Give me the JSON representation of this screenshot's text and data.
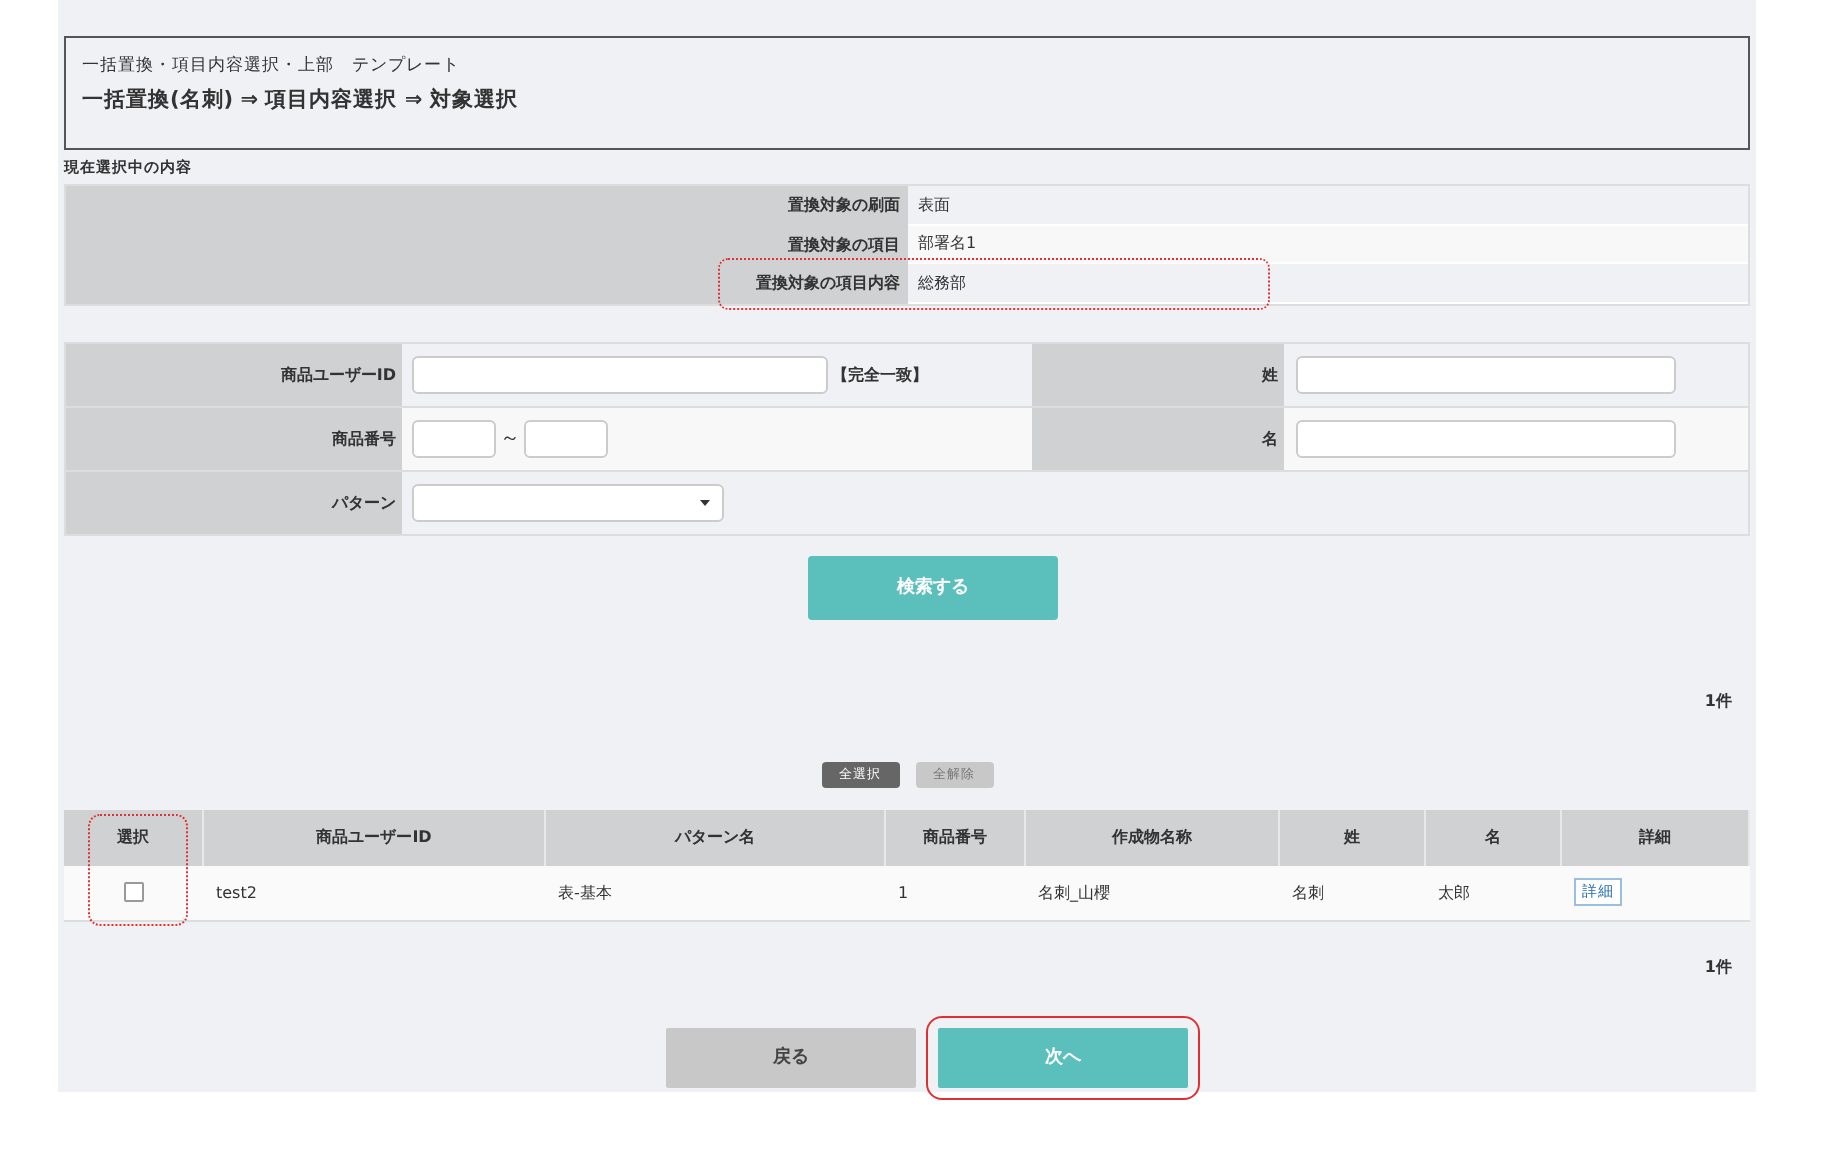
{
  "header": {
    "breadcrumb": "一括置換・項目内容選択・上部　テンプレート",
    "title": "一括置換(名刺) ⇒ 項目内容選択 ⇒ 対象選択"
  },
  "current_selection": {
    "heading": "現在選択中の内容",
    "rows": [
      {
        "label": "置換対象の刷面",
        "value": "表面",
        "highlighted": false
      },
      {
        "label": "置換対象の項目",
        "value": "部署名1",
        "highlighted": false
      },
      {
        "label": "置換対象の項目内容",
        "value": "総務部",
        "highlighted": true
      }
    ]
  },
  "search_form": {
    "user_id_label": "商品ユーザーID",
    "exact_match_note": "【完全一致】",
    "last_name_label": "姓",
    "product_number_label": "商品番号",
    "range_separator": "～",
    "first_name_label": "名",
    "pattern_label": "パターン",
    "search_button": "検索する"
  },
  "result_count_top": "1件",
  "select_all_button": "全選択",
  "deselect_all_button": "全解除",
  "table": {
    "columns": [
      {
        "label": "選択",
        "highlighted": true
      },
      {
        "label": "商品ユーザーID",
        "highlighted": false
      },
      {
        "label": "パターン名",
        "highlighted": false
      },
      {
        "label": "商品番号",
        "highlighted": false
      },
      {
        "label": "作成物名称",
        "highlighted": false
      },
      {
        "label": "姓",
        "highlighted": false
      },
      {
        "label": "名",
        "highlighted": false
      },
      {
        "label": "詳細",
        "highlighted": false
      }
    ],
    "rows": [
      {
        "checked": false,
        "user_id": "test2",
        "pattern": "表-基本",
        "product_number": "1",
        "product_name": "名刺_山櫻",
        "last_name": "名刺",
        "first_name": "太郎",
        "detail_link": "詳細"
      }
    ]
  },
  "result_count_bottom": "1件",
  "buttons": [
    {
      "label": "戻る",
      "kind": "back",
      "highlighted": false
    },
    {
      "label": "次へ",
      "kind": "next",
      "highlighted": true
    }
  ]
}
